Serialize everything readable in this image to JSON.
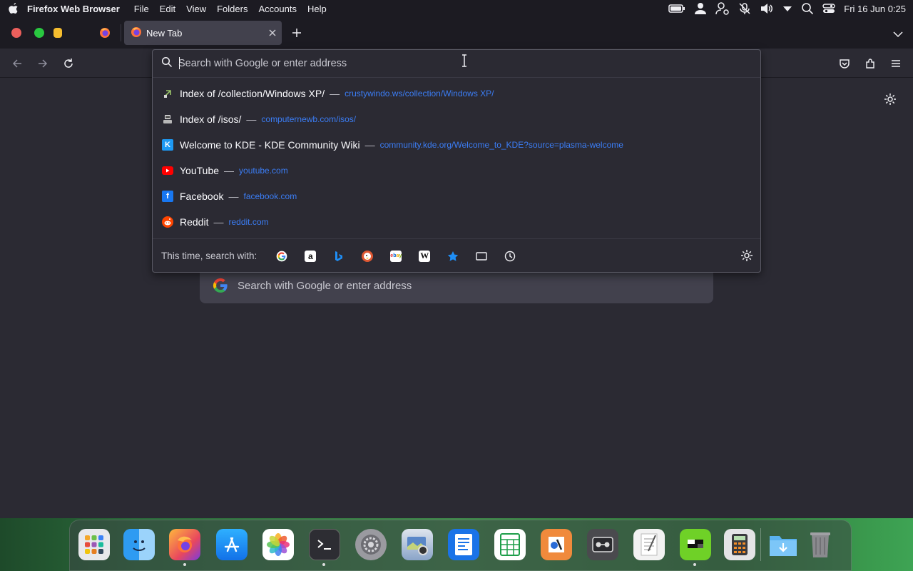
{
  "menubar": {
    "app_name": "Firefox Web Browser",
    "items": [
      "File",
      "Edit",
      "View",
      "Folders",
      "Accounts",
      "Help"
    ],
    "clock": "Fri 16 Jun 0:25"
  },
  "tab": {
    "title": "New Tab"
  },
  "urlbar": {
    "placeholder": "Search with Google or enter address",
    "results": [
      {
        "title": "Index of /collection/Windows XP/",
        "separator": "—",
        "url": "crustywindo.ws/collection/Windows XP/",
        "icon": "generic-site-icon"
      },
      {
        "title": "Index of /isos/",
        "separator": "—",
        "url": "computernewb.com/isos/",
        "icon": "computer-site-icon"
      },
      {
        "title": "Welcome to KDE - KDE Community Wiki",
        "separator": "—",
        "url": "community.kde.org/Welcome_to_KDE?source=plasma-welcome",
        "icon": "kde-icon"
      },
      {
        "title": "YouTube",
        "separator": "—",
        "url": "youtube.com",
        "icon": "youtube-icon"
      },
      {
        "title": "Facebook",
        "separator": "—",
        "url": "facebook.com",
        "icon": "facebook-icon"
      },
      {
        "title": "Reddit",
        "separator": "—",
        "url": "reddit.com",
        "icon": "reddit-icon"
      }
    ],
    "search_with_label": "This time, search with:",
    "engines": [
      "google-icon",
      "amazon-icon",
      "bing-icon",
      "duckduckgo-icon",
      "ebay-icon",
      "wikipedia-icon",
      "bookmarks-icon",
      "tabs-icon",
      "history-icon"
    ]
  },
  "page": {
    "search_placeholder": "Search with Google or enter address"
  },
  "dock": {
    "apps": [
      "launchpad-icon",
      "finder-icon",
      "firefox-icon",
      "app-store-icon",
      "photos-icon",
      "terminal-icon",
      "settings-icon",
      "image-viewer-icon",
      "writer-icon",
      "spreadsheet-icon",
      "draw-icon",
      "tape-icon",
      "text-editor-icon",
      "minecraft-icon",
      "calculator-icon",
      "downloads-icon",
      "trash-icon"
    ]
  },
  "colors": {
    "chrome": "#1c1b22",
    "content": "#2b2a33",
    "url_link": "#3b7df5",
    "close_red": "#ec5f5c",
    "minimize_yellow": "#f5bd2f",
    "maximize_green": "#29c840"
  }
}
